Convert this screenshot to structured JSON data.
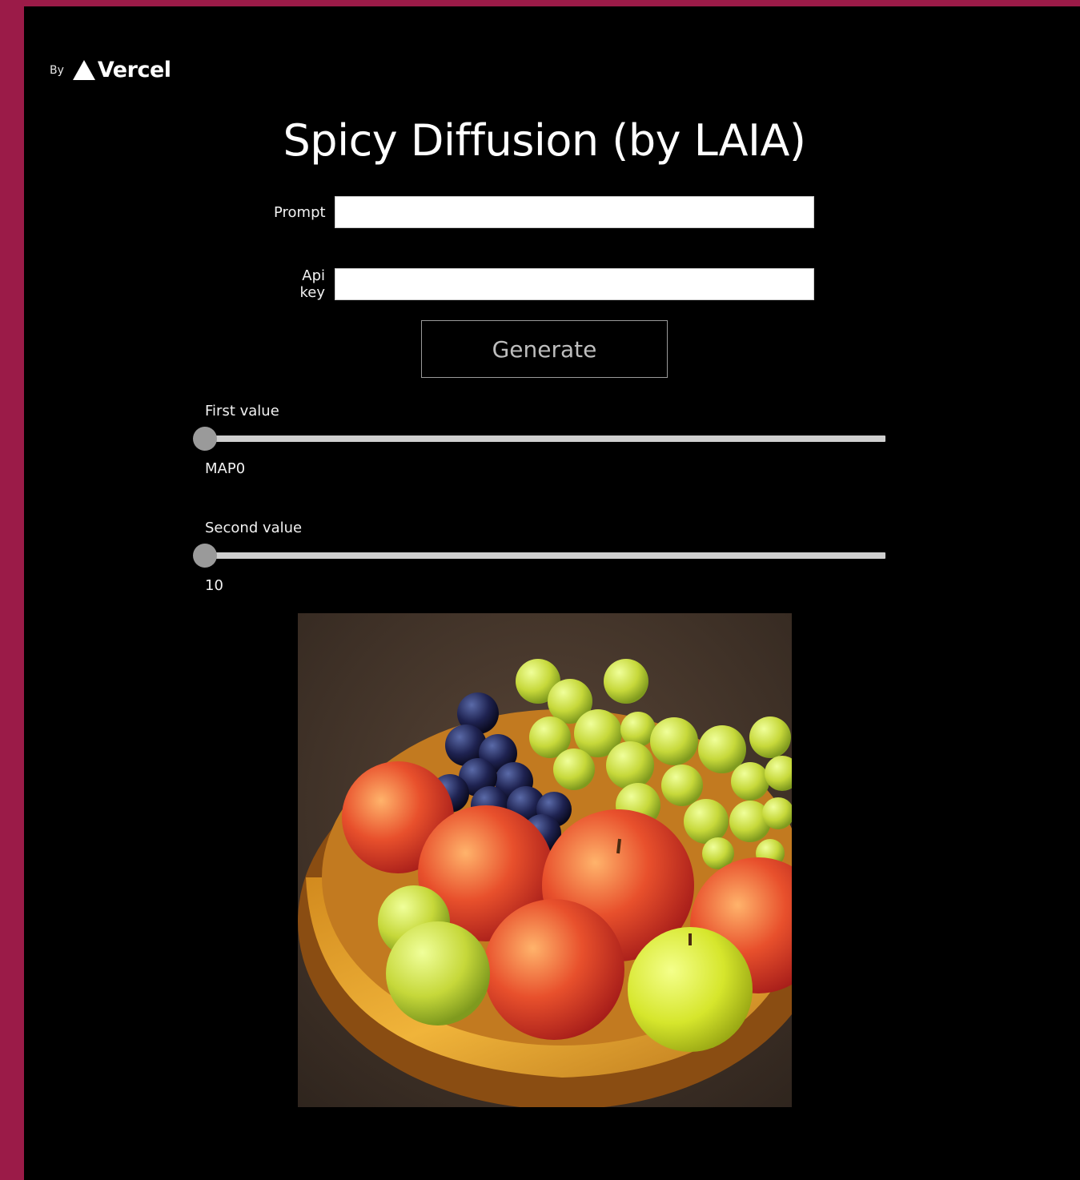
{
  "brand": {
    "prefix": "By",
    "name": "Vercel",
    "logo_icon": "vercel-triangle-icon"
  },
  "title": "Spicy Diffusion (by LAIA)",
  "form": {
    "prompt_label": "Prompt",
    "prompt_value": "",
    "apikey_label": "Api key",
    "apikey_value": "",
    "generate_label": "Generate"
  },
  "sliders": [
    {
      "label": "First value",
      "value_text": "MAP0",
      "position": 0
    },
    {
      "label": "Second value",
      "value_text": "10",
      "position": 0
    }
  ],
  "colors": {
    "frame": "#9b1b48",
    "background": "#000000",
    "rail": "#cfcfcf",
    "knob": "#9a9a9a"
  }
}
